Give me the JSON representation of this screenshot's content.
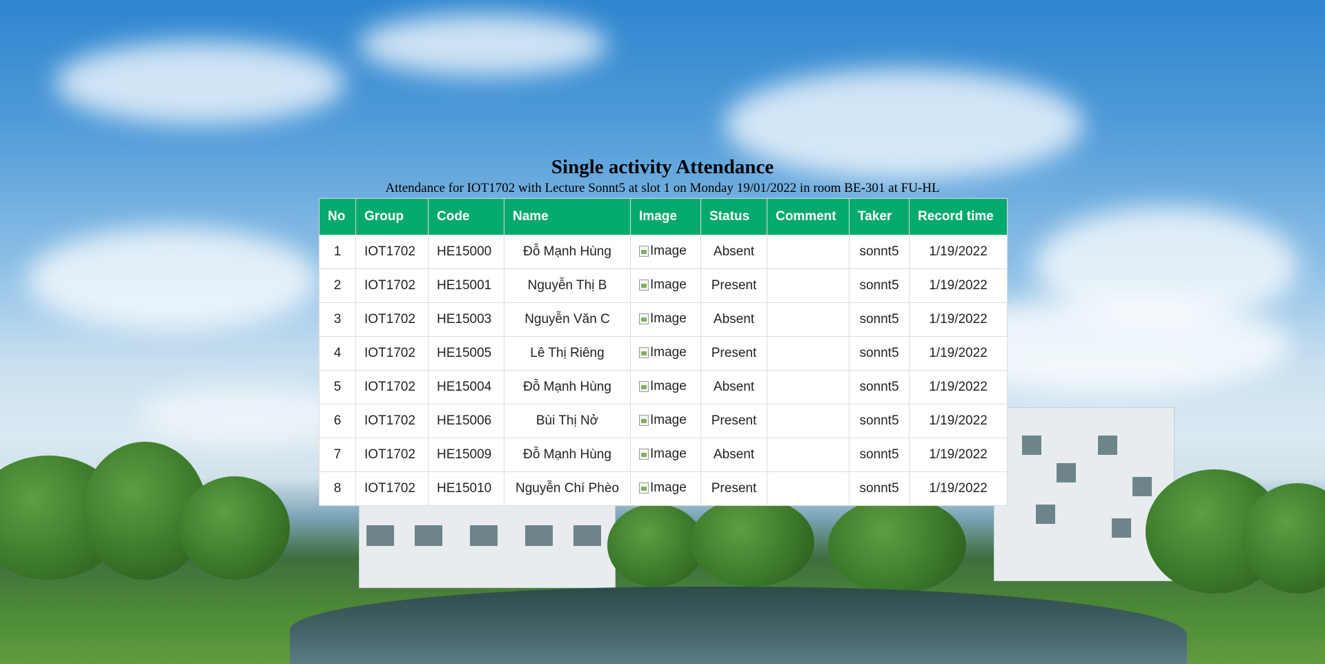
{
  "page": {
    "title": "Single activity Attendance",
    "subtitle": "Attendance for IOT1702 with Lecture Sonnt5 at slot 1 on Monday 19/01/2022 in room BE-301 at FU-HL"
  },
  "table": {
    "headers": [
      "No",
      "Group",
      "Code",
      "Name",
      "Image",
      "Status",
      "Comment",
      "Taker",
      "Record time"
    ],
    "rows": [
      {
        "no": "1",
        "group": "IOT1702",
        "code": "HE15000",
        "name": "Đỗ Mạnh Hùng",
        "image_alt": "Image",
        "status": "Absent",
        "comment": "",
        "taker": "sonnt5",
        "record_time": "1/19/2022"
      },
      {
        "no": "2",
        "group": "IOT1702",
        "code": "HE15001",
        "name": "Nguyễn Thị B",
        "image_alt": "Image",
        "status": "Present",
        "comment": "",
        "taker": "sonnt5",
        "record_time": "1/19/2022"
      },
      {
        "no": "3",
        "group": "IOT1702",
        "code": "HE15003",
        "name": "Nguyễn Văn C",
        "image_alt": "Image",
        "status": "Absent",
        "comment": "",
        "taker": "sonnt5",
        "record_time": "1/19/2022"
      },
      {
        "no": "4",
        "group": "IOT1702",
        "code": "HE15005",
        "name": "Lê Thị Riêng",
        "image_alt": "Image",
        "status": "Present",
        "comment": "",
        "taker": "sonnt5",
        "record_time": "1/19/2022"
      },
      {
        "no": "5",
        "group": "IOT1702",
        "code": "HE15004",
        "name": "Đỗ Mạnh Hùng",
        "image_alt": "Image",
        "status": "Absent",
        "comment": "",
        "taker": "sonnt5",
        "record_time": "1/19/2022"
      },
      {
        "no": "6",
        "group": "IOT1702",
        "code": "HE15006",
        "name": "Bùi Thị Nở",
        "image_alt": "Image",
        "status": "Present",
        "comment": "",
        "taker": "sonnt5",
        "record_time": "1/19/2022"
      },
      {
        "no": "7",
        "group": "IOT1702",
        "code": "HE15009",
        "name": "Đỗ Mạnh Hùng",
        "image_alt": "Image",
        "status": "Absent",
        "comment": "",
        "taker": "sonnt5",
        "record_time": "1/19/2022"
      },
      {
        "no": "8",
        "group": "IOT1702",
        "code": "HE15010",
        "name": "Nguyễn Chí Phèo",
        "image_alt": "Image",
        "status": "Present",
        "comment": "",
        "taker": "sonnt5",
        "record_time": "1/19/2022"
      }
    ]
  },
  "colors": {
    "header_bg": "#04aa6d",
    "header_text": "#ffffff",
    "row_bg": "#ffffff"
  }
}
